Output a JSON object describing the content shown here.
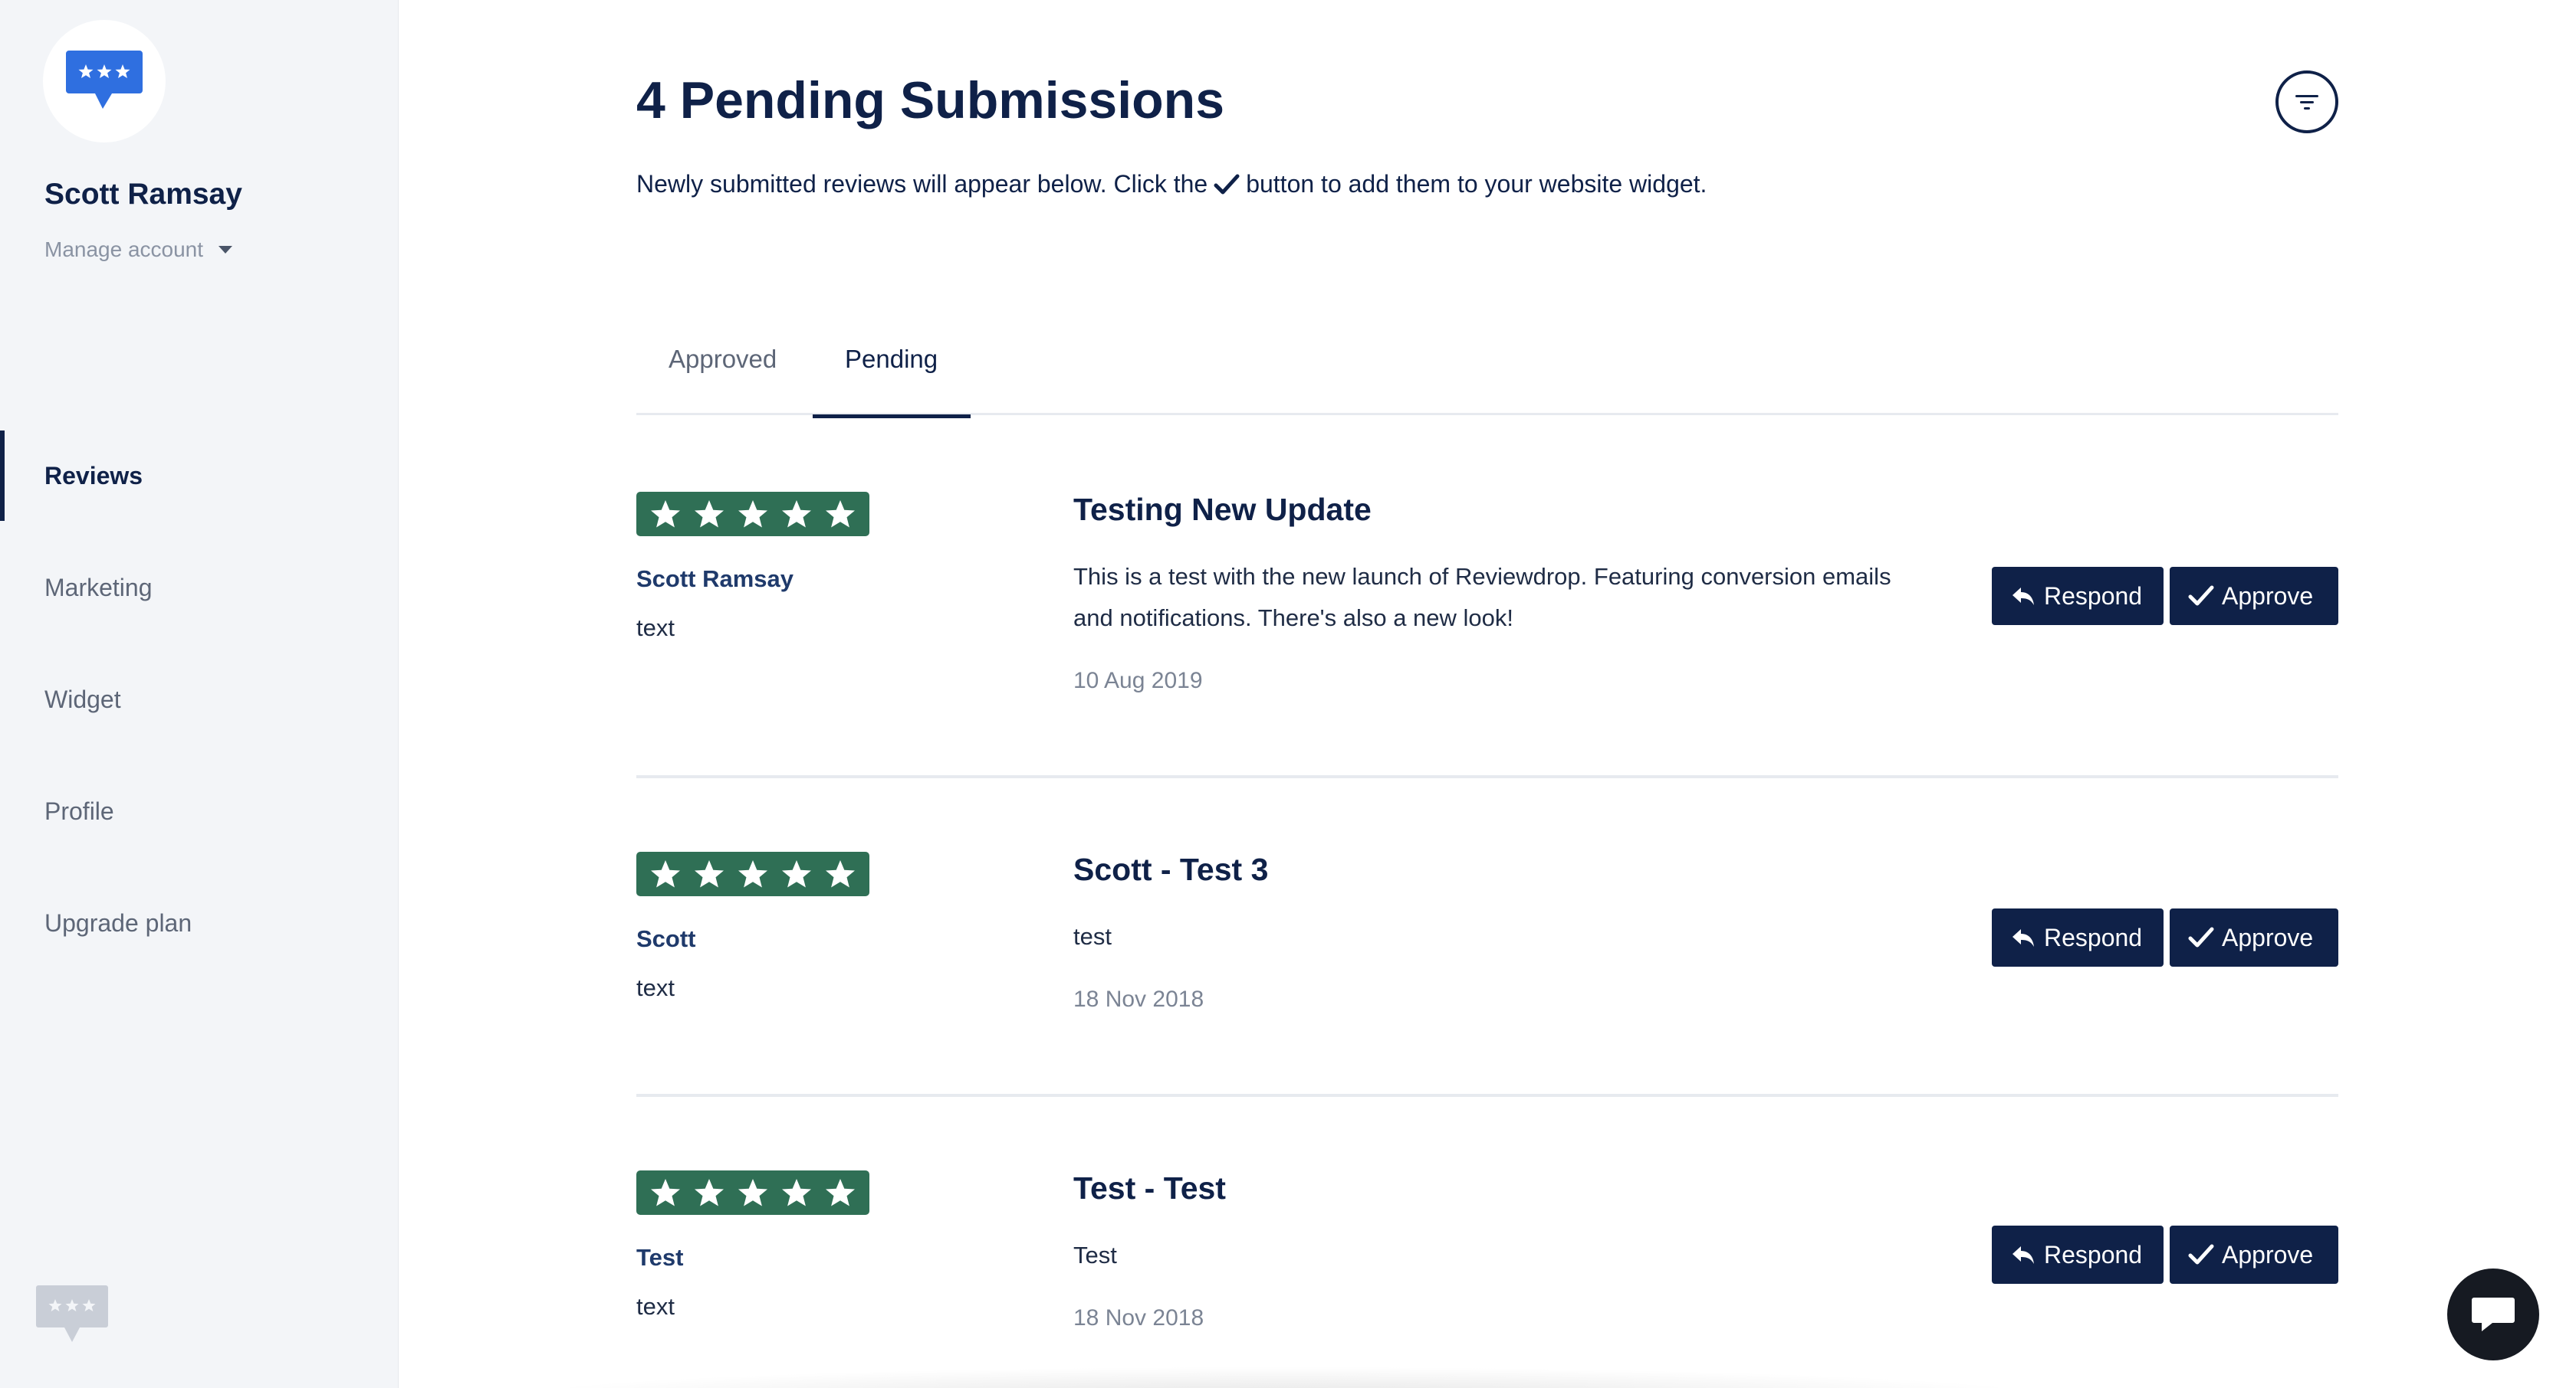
{
  "account": {
    "name": "Scott Ramsay",
    "manage_label": "Manage account"
  },
  "nav": {
    "items": [
      {
        "label": "Reviews",
        "active": true
      },
      {
        "label": "Marketing",
        "active": false
      },
      {
        "label": "Widget",
        "active": false
      },
      {
        "label": "Profile",
        "active": false
      },
      {
        "label": "Upgrade plan",
        "active": false
      }
    ]
  },
  "header": {
    "title": "4 Pending Submissions",
    "subtitle_before": "Newly submitted reviews will appear below. Click the",
    "subtitle_after": "button to add them to your website widget."
  },
  "tabs": [
    {
      "label": "Approved",
      "active": false
    },
    {
      "label": "Pending",
      "active": true
    }
  ],
  "actions": {
    "respond_label": "Respond",
    "approve_label": "Approve"
  },
  "reviews": [
    {
      "rating": 5,
      "author": "Scott Ramsay",
      "source": "text",
      "title": "Testing New Update",
      "body": "This is a test with the new launch of Reviewdrop. Featuring conversion emails and notifications. There's also a new look!",
      "date": "10 Aug 2019"
    },
    {
      "rating": 5,
      "author": "Scott",
      "source": "text",
      "title": "Scott - Test 3",
      "body": "test",
      "date": "18 Nov 2018"
    },
    {
      "rating": 5,
      "author": "Test",
      "source": "text",
      "title": "Test - Test",
      "body": "Test",
      "date": "18 Nov 2018"
    }
  ],
  "colors": {
    "brand_navy": "#0f2148",
    "star_green": "#2f6f55",
    "logo_blue": "#2f6fe0",
    "sidebar_bg": "#f3f5f8"
  },
  "icons": {
    "logo": "speech-bubble-stars-icon",
    "filter": "filter-lines-icon",
    "respond": "reply-arrow-icon",
    "approve": "checkmark-icon",
    "chat": "chat-bubble-icon"
  }
}
